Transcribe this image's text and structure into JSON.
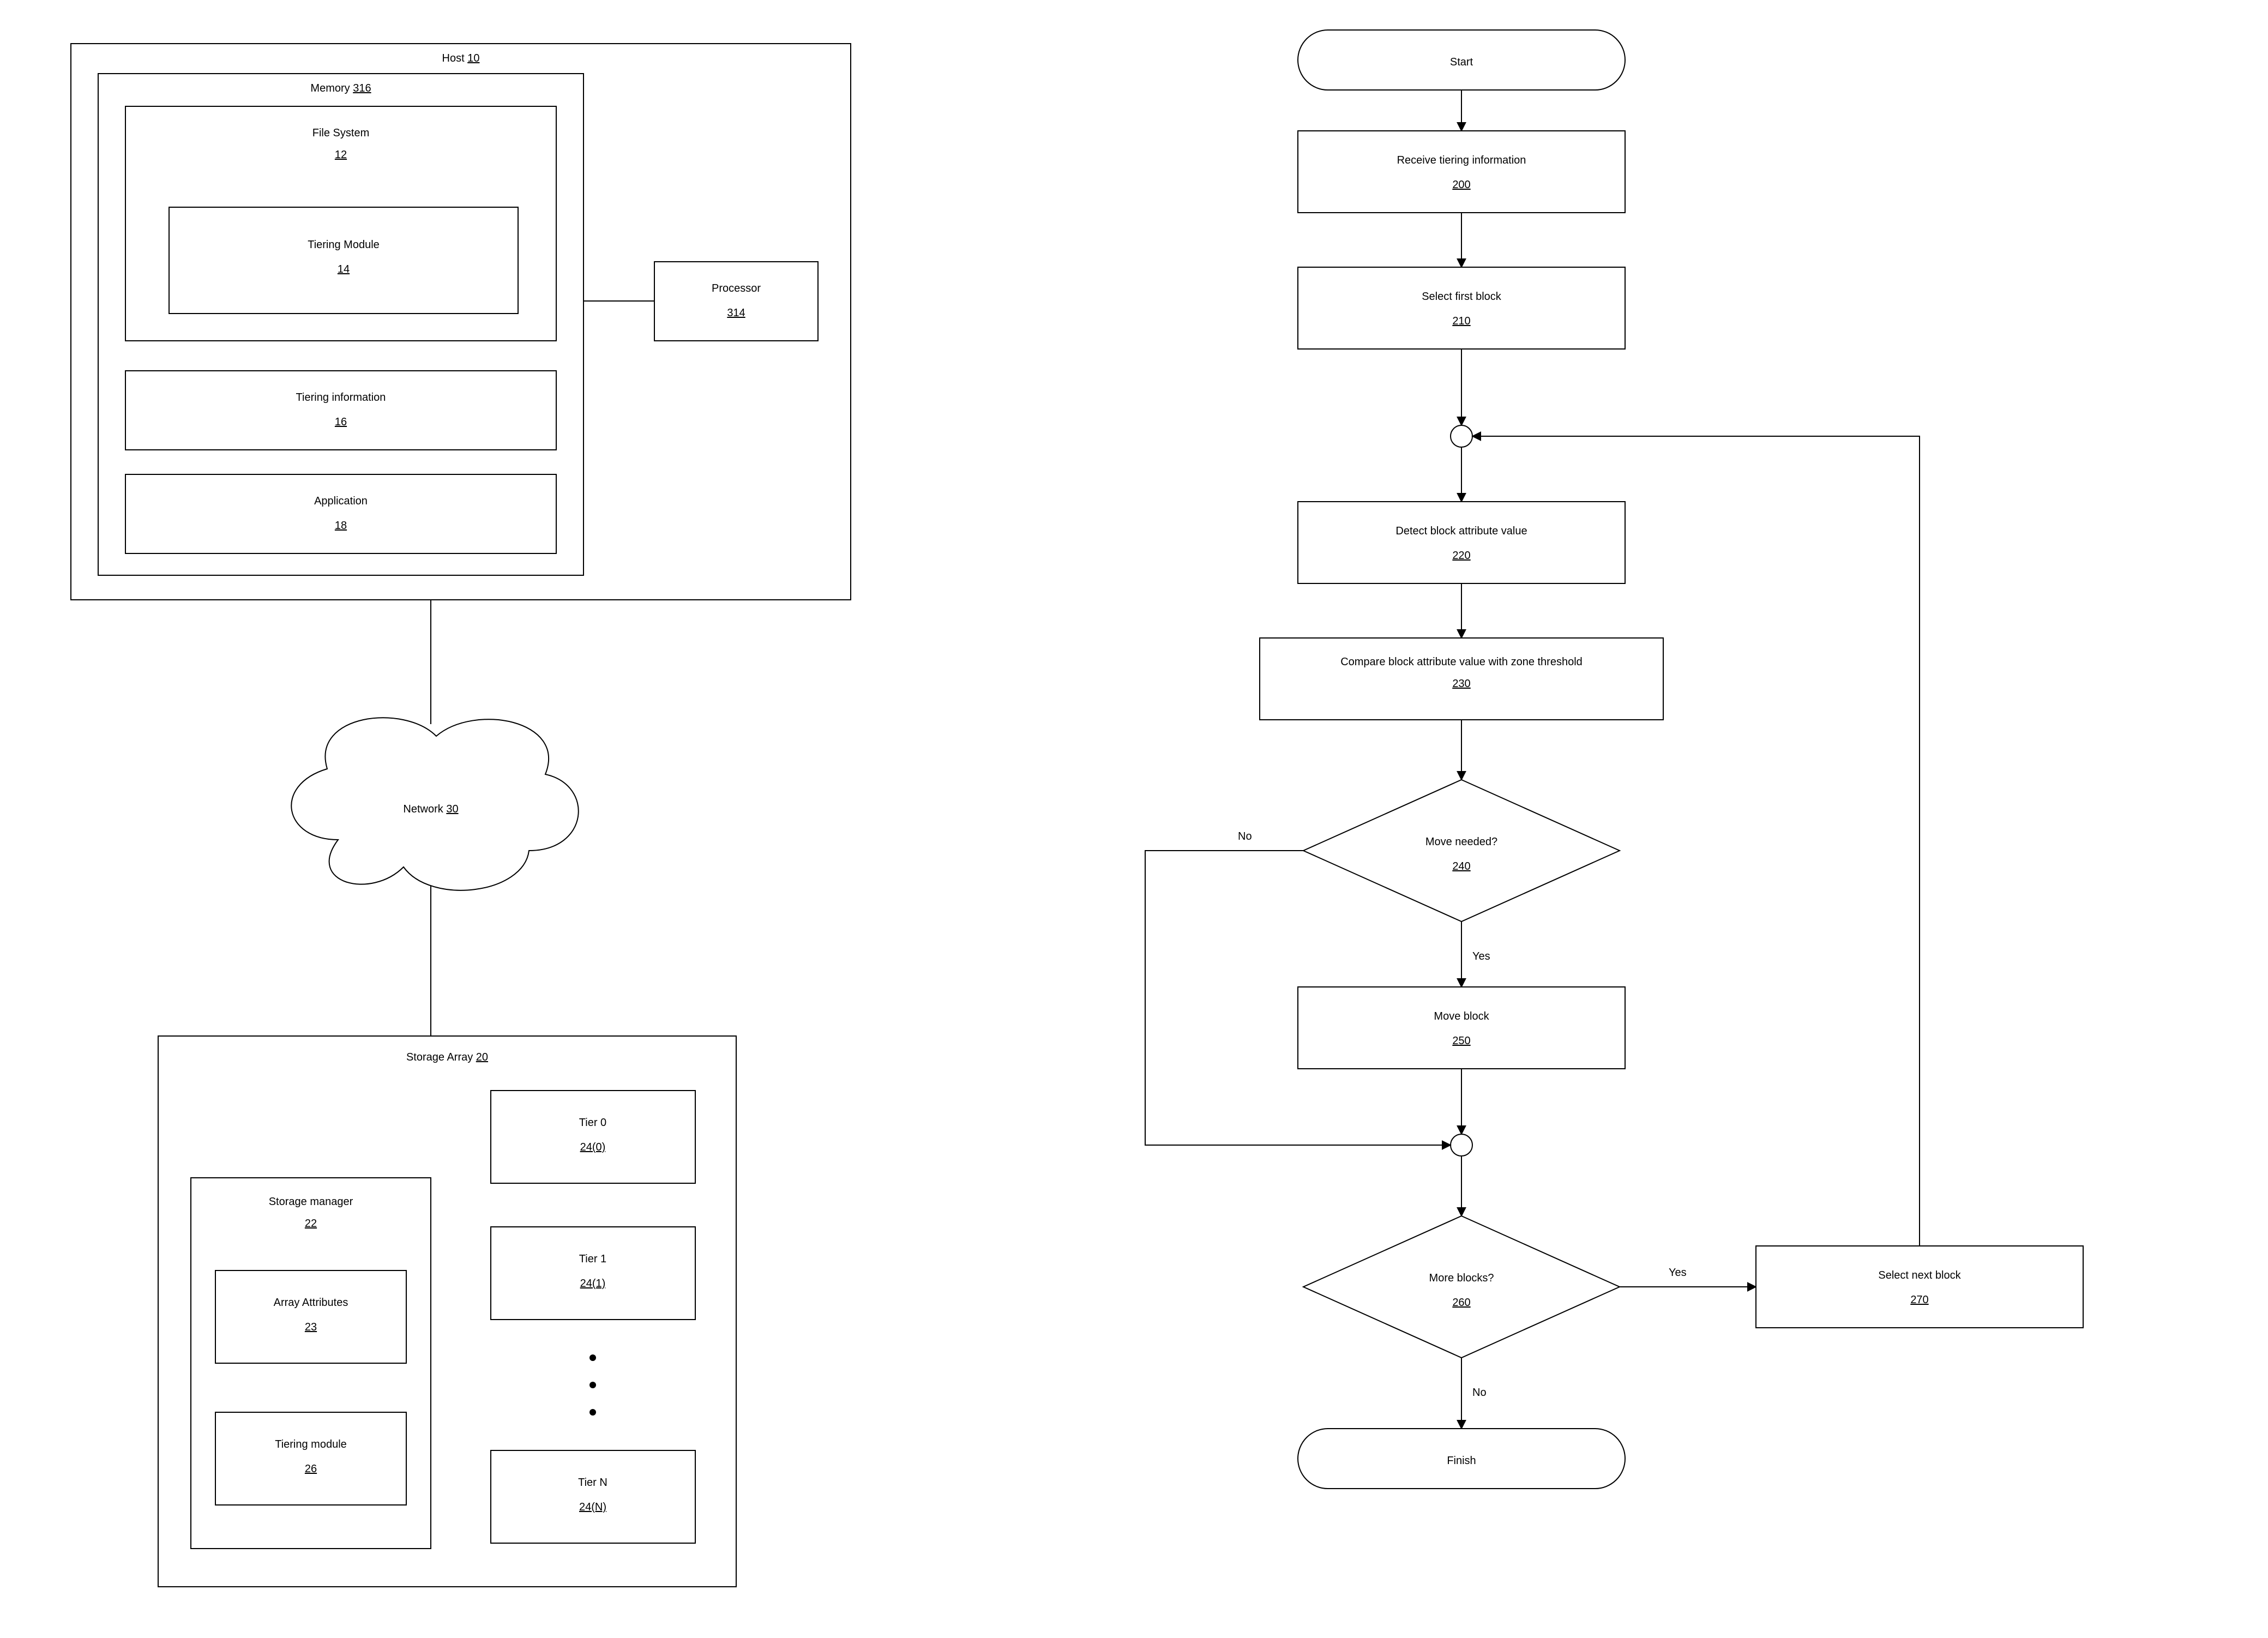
{
  "left": {
    "host": {
      "label": "Host",
      "num": "10"
    },
    "memory": {
      "label": "Memory",
      "num": "316"
    },
    "fs": {
      "label": "File System",
      "num": "12"
    },
    "tmod": {
      "label": "Tiering Module",
      "num": "14"
    },
    "tinfo": {
      "label": "Tiering information",
      "num": "16"
    },
    "app": {
      "label": "Application",
      "num": "18"
    },
    "processor": {
      "label": "Processor",
      "num": "314"
    },
    "network": {
      "label": "Network",
      "num": "30"
    },
    "sarray": {
      "label": "Storage Array",
      "num": "20"
    },
    "smgr": {
      "label": "Storage manager",
      "num": "22"
    },
    "aattr": {
      "label": "Array Attributes",
      "num": "23"
    },
    "tmod2": {
      "label": "Tiering module",
      "num": "26"
    },
    "tier0": {
      "label": "Tier 0",
      "num": "24(0)"
    },
    "tier1": {
      "label": "Tier 1",
      "num": "24(1)"
    },
    "tierN": {
      "label": "Tier N",
      "num": "24(N)"
    }
  },
  "flow": {
    "start": {
      "label": "Start"
    },
    "s200": {
      "label": "Receive tiering information",
      "num": "200"
    },
    "s210": {
      "label": "Select first block",
      "num": "210"
    },
    "s220": {
      "label": "Detect block attribute value",
      "num": "220"
    },
    "s230": {
      "label": "Compare block attribute value with zone threshold",
      "num": "230"
    },
    "d240": {
      "label": "Move needed?",
      "num": "240"
    },
    "s250": {
      "label": "Move block",
      "num": "250"
    },
    "d260": {
      "label": "More blocks?",
      "num": "260"
    },
    "s270": {
      "label": "Select next block",
      "num": "270"
    },
    "finish": {
      "label": "Finish"
    },
    "edge240_no": "No",
    "edge240_yes": "Yes",
    "edge260_yes": "Yes",
    "edge260_no": "No"
  }
}
